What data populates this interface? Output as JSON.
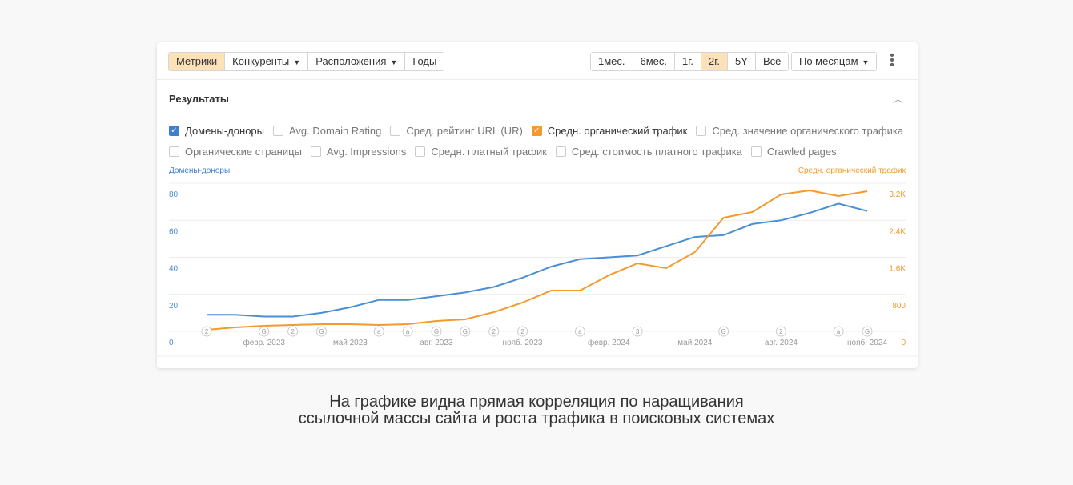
{
  "toolbar": {
    "tabs": [
      {
        "label": "Метрики",
        "active": true
      },
      {
        "label": "Конкуренты",
        "dropdown": true
      },
      {
        "label": "Расположения",
        "dropdown": true
      },
      {
        "label": "Годы"
      }
    ],
    "ranges": [
      {
        "label": "1мес."
      },
      {
        "label": "6мес."
      },
      {
        "label": "1г."
      },
      {
        "label": "2г.",
        "active": true
      },
      {
        "label": "5Y"
      },
      {
        "label": "Все"
      }
    ],
    "granularity": "По месяцам",
    "more_icon": "kebab-icon"
  },
  "section": {
    "title": "Результаты",
    "collapse_icon": "chevron-up-icon"
  },
  "metrics": [
    [
      {
        "label": "Домены-доноры",
        "checked": true,
        "color": "#3f7fd1"
      },
      {
        "label": "Avg. Domain Rating"
      },
      {
        "label": "Сред. рейтинг URL (UR)"
      },
      {
        "label": "Средн. органический трафик",
        "checked": true,
        "color": "#f39a2e"
      },
      {
        "label": "Сред. значение органического трафика"
      }
    ],
    [
      {
        "label": "Органические страницы"
      },
      {
        "label": "Avg. Impressions"
      },
      {
        "label": "Средн. платный трафик"
      },
      {
        "label": "Сред. стоимость платного трафика"
      },
      {
        "label": "Crawled pages"
      }
    ]
  ],
  "chart_data": {
    "type": "line",
    "left_axis_title": "Домены-доноры",
    "right_axis_title": "Средн. органический трафик",
    "left_ticks": [
      "0",
      "20",
      "40",
      "60",
      "80"
    ],
    "right_ticks": [
      "0",
      "800",
      "1.6K",
      "2.4K",
      "3.2K"
    ],
    "ylim_left": [
      0,
      80
    ],
    "ylim_right": [
      0,
      3200
    ],
    "grid": true,
    "x_ticks": [
      {
        "label": "февр. 2023",
        "i": 2
      },
      {
        "label": "май 2023",
        "i": 5
      },
      {
        "label": "авг. 2023",
        "i": 8
      },
      {
        "label": "нояб. 2023",
        "i": 11
      },
      {
        "label": "февр. 2024",
        "i": 14
      },
      {
        "label": "май 2024",
        "i": 17
      },
      {
        "label": "авг. 2024",
        "i": 20
      },
      {
        "label": "нояб. 2024",
        "i": 23
      }
    ],
    "series": [
      {
        "name": "Домены-доноры",
        "axis": "left",
        "color": "#4a8fd4",
        "values": [
          9,
          9,
          8,
          8,
          10,
          13,
          17,
          17,
          19,
          21,
          24,
          29,
          35,
          39,
          40,
          41,
          46,
          51,
          52,
          58,
          60,
          64,
          69,
          65
        ]
      },
      {
        "name": "Средн. органический трафик",
        "axis": "right",
        "color": "#f39a2e",
        "values": [
          35,
          86,
          121,
          138,
          156,
          156,
          138,
          156,
          225,
          260,
          415,
          623,
          882,
          882,
          1211,
          1470,
          1366,
          1713,
          2457,
          2578,
          2958,
          3045,
          2924,
          3027
        ]
      }
    ],
    "annotations": [
      {
        "i": 0,
        "t": "2"
      },
      {
        "i": 2,
        "t": "G"
      },
      {
        "i": 3,
        "t": "2"
      },
      {
        "i": 4,
        "t": "G"
      },
      {
        "i": 6,
        "t": "a"
      },
      {
        "i": 7,
        "t": "a"
      },
      {
        "i": 8,
        "t": "G"
      },
      {
        "i": 9,
        "t": "G"
      },
      {
        "i": 10,
        "t": "2"
      },
      {
        "i": 11,
        "t": "2"
      },
      {
        "i": 13,
        "t": "a"
      },
      {
        "i": 15,
        "t": "3"
      },
      {
        "i": 18,
        "t": "G"
      },
      {
        "i": 20,
        "t": "2"
      },
      {
        "i": 22,
        "t": "a"
      },
      {
        "i": 23,
        "t": "G"
      }
    ]
  },
  "caption": "На графике видна прямая корреляция по наращивания ссылочной массы сайта и роста трафика в поисковых системах"
}
